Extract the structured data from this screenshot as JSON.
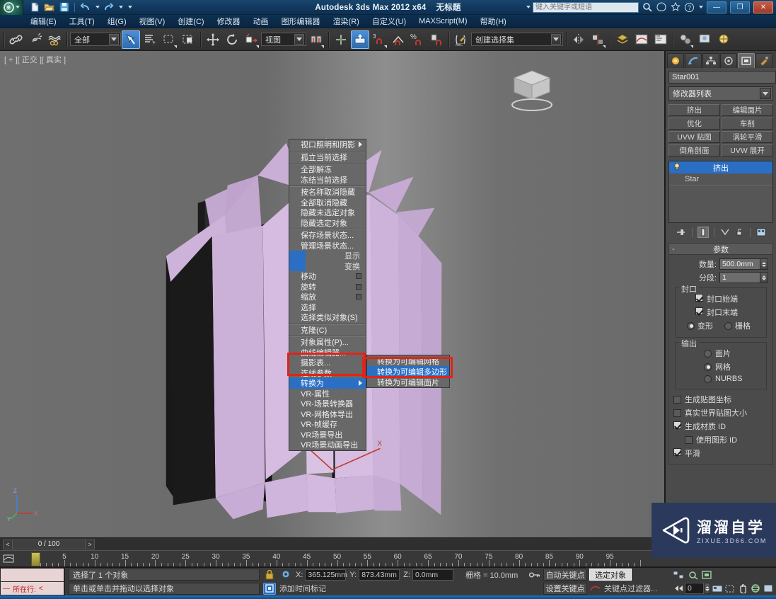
{
  "titlebar": {
    "app_title": "Autodesk 3ds Max  2012 x64",
    "document_title": "无标题",
    "search_placeholder": "键入关键字或短语",
    "logo_label": "3",
    "quick_access": [
      {
        "name": "new-file-icon",
        "label": "新建"
      },
      {
        "name": "open-file-icon",
        "label": "打开"
      },
      {
        "name": "save-file-icon",
        "label": "保存"
      },
      {
        "name": "undo-icon",
        "label": "撤消"
      },
      {
        "name": "redo-icon",
        "label": "重做"
      },
      {
        "name": "customize-qat-icon",
        "label": "自定义快速访问工具栏"
      }
    ],
    "window_buttons": [
      {
        "name": "minimize-button",
        "label": "—"
      },
      {
        "name": "maximize-button",
        "label": "❐"
      },
      {
        "name": "close-button",
        "label": "✕"
      }
    ]
  },
  "menubar": {
    "items": [
      "编辑(E)",
      "工具(T)",
      "组(G)",
      "视图(V)",
      "创建(C)",
      "修改器",
      "动画",
      "图形编辑器",
      "渲染(R)",
      "自定义(U)",
      "MAXScript(M)",
      "帮助(H)"
    ]
  },
  "toolbar": {
    "selection_filter": "全部",
    "reference_coord": "视图",
    "named_selection_sets": "创建选择集",
    "buttons": [
      {
        "name": "select-link-icon",
        "label": "选择并链接"
      },
      {
        "name": "unlink-icon",
        "label": "断开当前选择链接"
      },
      {
        "name": "bind-space-warp-icon",
        "label": "绑定到空间扭曲"
      },
      {
        "name": "select-object-icon",
        "label": "选择对象"
      },
      {
        "name": "select-by-name-icon",
        "label": "按名称选择"
      },
      {
        "name": "rectangular-region-icon",
        "label": "矩形选择区域"
      },
      {
        "name": "window-crossing-icon",
        "label": "窗口/交叉"
      },
      {
        "name": "select-move-icon",
        "label": "选择并移动"
      },
      {
        "name": "select-rotate-icon",
        "label": "选择并旋转"
      },
      {
        "name": "select-scale-icon",
        "label": "选择并均匀缩放"
      },
      {
        "name": "mirror-icon",
        "label": "镜像"
      },
      {
        "name": "align-icon",
        "label": "对齐"
      },
      {
        "name": "snap-toggle-icon",
        "label": "捕捉开关"
      },
      {
        "name": "angle-snap-icon",
        "label": "角度捕捉切换"
      },
      {
        "name": "percent-snap-icon",
        "label": "百分比捕捉切换"
      },
      {
        "name": "spinner-snap-icon",
        "label": "微调器捕捉切换"
      },
      {
        "name": "edit-named-selection-icon",
        "label": "编辑命名选择集"
      }
    ]
  },
  "viewport": {
    "label": "[ + ][ 正交 ][ 真实 ]",
    "axis_labels": {
      "x": "X",
      "y": "Y",
      "z": "Z"
    }
  },
  "context_menu": {
    "groups": [
      {
        "items": [
          {
            "label": "视口照明和阴影",
            "submenu": true
          }
        ]
      },
      {
        "items": [
          {
            "label": "孤立当前选择"
          }
        ]
      },
      {
        "items": [
          {
            "label": "全部解冻"
          },
          {
            "label": "冻结当前选择"
          }
        ]
      },
      {
        "items": [
          {
            "label": "按名称取消隐藏"
          },
          {
            "label": "全部取消隐藏"
          },
          {
            "label": "隐藏未选定对象"
          },
          {
            "label": "隐藏选定对象"
          }
        ]
      },
      {
        "items": [
          {
            "label": "保存场景状态..."
          },
          {
            "label": "管理场景状态..."
          }
        ]
      }
    ],
    "split_rows": [
      {
        "label": "显示"
      },
      {
        "label": "变换"
      }
    ],
    "transform_items": [
      {
        "label": "移动",
        "settings_box": true
      },
      {
        "label": "旋转",
        "settings_box": true
      },
      {
        "label": "缩放",
        "settings_box": true
      },
      {
        "label": "选择"
      },
      {
        "label": "选择类似对象(S)"
      }
    ],
    "clone_item": {
      "label": "克隆(C)"
    },
    "props_items": [
      {
        "label": "对象属性(P)..."
      },
      {
        "label": "曲线编辑器..."
      },
      {
        "label": "摄影表..."
      },
      {
        "label": "连线参数..."
      }
    ],
    "convert_item": {
      "label": "转换为",
      "submenu": true,
      "highlighted": true
    },
    "vray_items": [
      {
        "label": "VR-属性"
      },
      {
        "label": "VR-场景转换器"
      },
      {
        "label": "VR-网格体导出"
      },
      {
        "label": "VR-帧缓存"
      },
      {
        "label": "VR场景导出"
      },
      {
        "label": "VR场景动画导出"
      }
    ]
  },
  "submenu": {
    "items": [
      {
        "label": "转换为可编辑网格",
        "selected": false
      },
      {
        "label": "转换为可编辑多边形",
        "selected": true
      },
      {
        "label": "转换为可编辑面片",
        "selected": false
      }
    ]
  },
  "command_panel": {
    "tabs": [
      {
        "name": "create-tab",
        "label": "创建",
        "active": false
      },
      {
        "name": "modify-tab",
        "label": "修改",
        "active": false
      },
      {
        "name": "hierarchy-tab",
        "label": "层次",
        "active": false
      },
      {
        "name": "motion-tab",
        "label": "运动",
        "active": false
      },
      {
        "name": "display-tab",
        "label": "显示",
        "active": true
      },
      {
        "name": "utilities-tab",
        "label": "工具",
        "active": false
      }
    ],
    "object_name": "Star001",
    "object_color": "#e0a9e8",
    "modifier_list_label": "修改器列表",
    "modifier_buttons": [
      "挤出",
      "编辑面片",
      "优化",
      "车削",
      "UVW 贴图",
      "涡轮平滑",
      "倒角剖面",
      "UVW 展开"
    ],
    "stack": [
      {
        "label": "挤出",
        "selected": true
      },
      {
        "label": "Star",
        "selected": false
      }
    ],
    "stack_tools": [
      {
        "name": "pin-stack-icon",
        "label": "固定堆栈"
      },
      {
        "name": "show-end-result-icon",
        "label": "显示最终结果",
        "active": true
      },
      {
        "name": "make-unique-icon",
        "label": "使唯一"
      },
      {
        "name": "remove-modifier-icon",
        "label": "从堆栈中移除修改器"
      },
      {
        "name": "configure-modifier-sets-icon",
        "label": "配置修改器集"
      }
    ],
    "params_rollup": {
      "title": "参数",
      "amount_label": "数量:",
      "amount_value": "500.0mm",
      "segments_label": "分段:",
      "segments_value": "1",
      "capping": {
        "title": "封口",
        "cap_start_label": "封口始端",
        "cap_start_checked": true,
        "cap_end_label": "封口末端",
        "cap_end_checked": true,
        "morph_label": "变形",
        "grid_label": "栅格",
        "selected": "变形"
      },
      "output": {
        "title": "输出",
        "options": [
          "面片",
          "网格",
          "NURBS"
        ],
        "selected": "网格"
      },
      "gen_map_coords_label": "生成贴图坐标",
      "gen_map_coords_checked": false,
      "real_world_size_label": "真实世界贴图大小",
      "real_world_size_checked": false,
      "gen_mat_ids_label": "生成材质 ID",
      "gen_mat_ids_checked": true,
      "use_shape_ids_label": "使用图形 ID",
      "use_shape_ids_checked": false,
      "smooth_label": "平滑",
      "smooth_checked": true
    }
  },
  "timeline": {
    "frame_display": "0 / 100",
    "prev_label": "<",
    "next_label": ">",
    "ticks": [
      "5",
      "10",
      "15",
      "20",
      "25",
      "30",
      "35",
      "40",
      "45",
      "50",
      "55",
      "60",
      "65",
      "70",
      "75",
      "80",
      "85",
      "90",
      "95"
    ],
    "current_frame": 0
  },
  "statusbar": {
    "listener_prompt": "所在行:",
    "listener_dash": "—",
    "listener_caret": "<",
    "selection_status": "选择了 1 个对象",
    "prompt_line": "单击或单击并拖动以选择对象",
    "lock_icon": "lock-selection-icon",
    "coords": [
      {
        "axis": "X:",
        "value": "365.125mm"
      },
      {
        "axis": "Y:",
        "value": "873.43mm"
      },
      {
        "axis": "Z:",
        "value": "0.0mm"
      }
    ],
    "grid_label": "栅格 = 10.0mm",
    "add_time_tag": "添加时间标记",
    "auto_key": "自动关键点",
    "set_key": "设置关键点",
    "selected_objects": "选定对象",
    "key_filters": "关键点过滤器...",
    "spinner_value": "0",
    "nav_buttons": [
      {
        "name": "zoom-icon",
        "label": "缩放"
      },
      {
        "name": "zoom-all-icon",
        "label": "缩放所有视图"
      },
      {
        "name": "zoom-extents-icon",
        "label": "最大化显示"
      },
      {
        "name": "field-of-view-icon",
        "label": "视野"
      },
      {
        "name": "pan-icon",
        "label": "平移视图"
      },
      {
        "name": "orbit-icon",
        "label": "环绕"
      },
      {
        "name": "maximize-viewport-icon",
        "label": "最大化视口切换"
      }
    ]
  },
  "watermark": {
    "title": "溜溜自学",
    "url": "ZIXUE.3D66.COM"
  },
  "colors": {
    "accent_blue": "#2a6fc4",
    "highlight_red": "#e2231a",
    "object_color": "#c9a9d4",
    "panel_gray": "#4b4b4b"
  }
}
